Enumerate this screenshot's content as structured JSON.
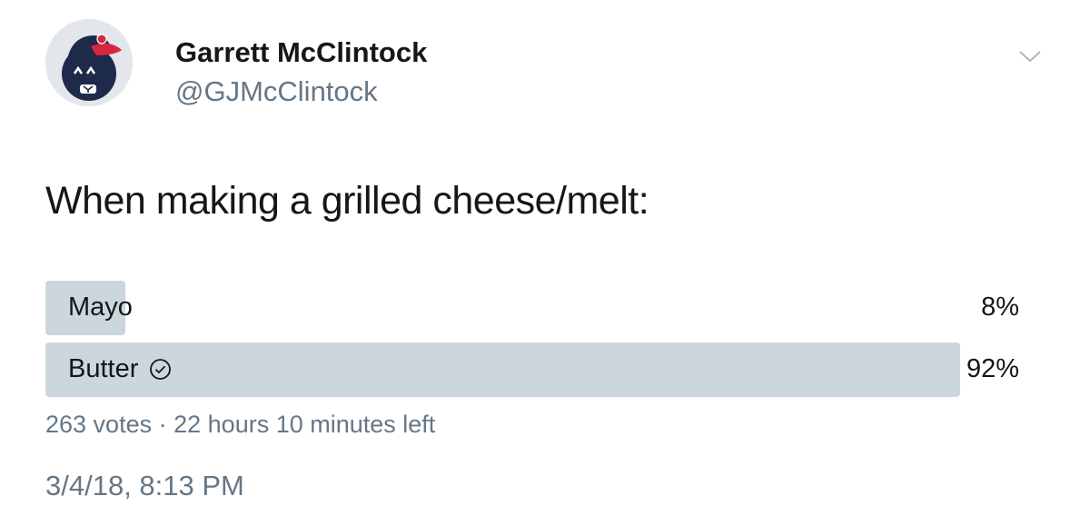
{
  "author": {
    "name": "Garrett McClintock",
    "handle": "@GJMcClintock"
  },
  "tweet": {
    "text": "When making a grilled cheese/melt:"
  },
  "poll": {
    "options": [
      {
        "label": "Mayo",
        "percent_text": "8%",
        "share": 0.08,
        "selected": false
      },
      {
        "label": "Butter",
        "percent_text": "92%",
        "share": 0.92,
        "selected": true
      }
    ],
    "votes": "263 votes",
    "separator": "·",
    "time_left": "22 hours 10 minutes left"
  },
  "timestamp": "3/4/18, 8:13 PM",
  "icons": {
    "menu": "chevron-down-icon",
    "selected": "check-circle-icon"
  },
  "colors": {
    "text_primary": "#14171a",
    "text_secondary": "#657786",
    "poll_fill": "#ccd6dd",
    "avatar_ball": "#1d2a4a",
    "avatar_cap": "#d7263d"
  }
}
